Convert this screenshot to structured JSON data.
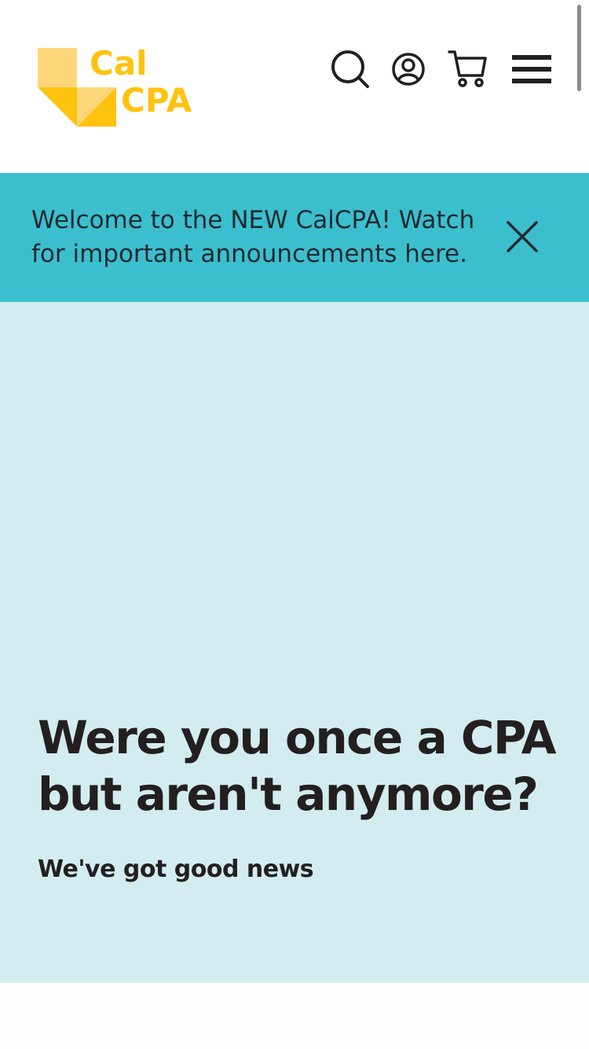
{
  "brand": {
    "logo_line1": "Cal",
    "logo_line2": "CPA",
    "logo_color": "#ffc20e",
    "logo_color_light": "#ffd466"
  },
  "header": {
    "icons": [
      "search-icon",
      "account-icon",
      "cart-icon",
      "menu-icon"
    ]
  },
  "announcement": {
    "text": "Welcome to the NEW CalCPA! Watch for important announcements here.",
    "background": "#3bbfcf"
  },
  "hero": {
    "title": "Were you once a CPA but aren't anymore?",
    "subtitle": "We've got good news",
    "background": "#d3ecf0"
  },
  "colors": {
    "text": "#231f20"
  }
}
